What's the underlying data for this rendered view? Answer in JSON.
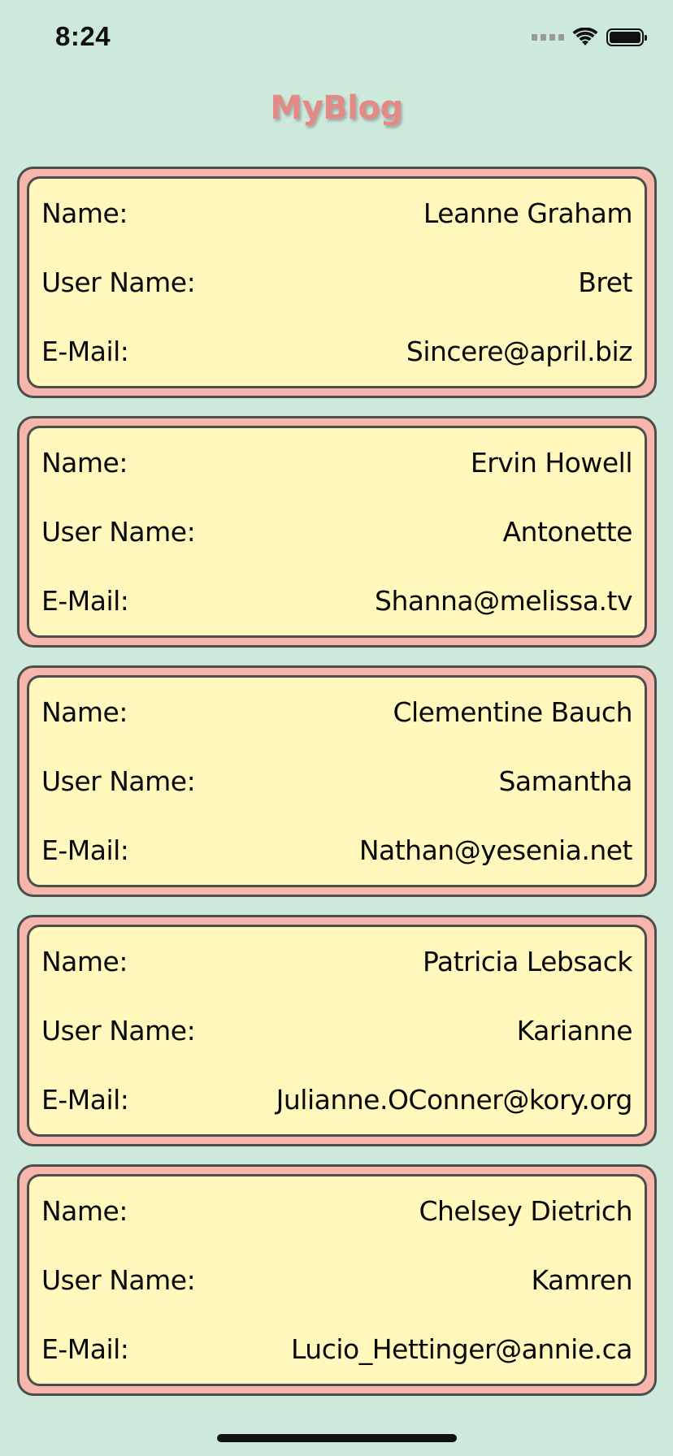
{
  "status_bar": {
    "time": "8:24",
    "icons": [
      "signal-icon",
      "wifi-icon",
      "battery-icon"
    ]
  },
  "header": {
    "title": "MyBlog"
  },
  "labels": {
    "name": "Name:",
    "username": "User Name:",
    "email": "E-Mail:"
  },
  "users": [
    {
      "name": "Leanne Graham",
      "username": "Bret",
      "email": "Sincere@april.biz"
    },
    {
      "name": "Ervin Howell",
      "username": "Antonette",
      "email": "Shanna@melissa.tv"
    },
    {
      "name": "Clementine Bauch",
      "username": "Samantha",
      "email": "Nathan@yesenia.net"
    },
    {
      "name": "Patricia Lebsack",
      "username": "Karianne",
      "email": "Julianne.OConner@kory.org"
    },
    {
      "name": "Chelsey Dietrich",
      "username": "Kamren",
      "email": "Lucio_Hettinger@annie.ca"
    }
  ],
  "colors": {
    "background": "#cde9dc",
    "card_outer": "#f7b6ab",
    "card_inner": "#fff7bb",
    "title": "#e48a86",
    "border": "#4d4d4d"
  }
}
